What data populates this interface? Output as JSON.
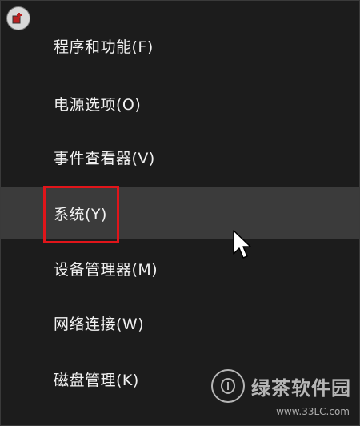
{
  "menu": {
    "items": [
      {
        "label": "程序和功能(F)"
      },
      {
        "label": "电源选项(O)"
      },
      {
        "label": "事件查看器(V)"
      },
      {
        "label": "系统(Y)"
      },
      {
        "label": "设备管理器(M)"
      },
      {
        "label": "网络连接(W)"
      },
      {
        "label": "磁盘管理(K)"
      }
    ],
    "hovered_index": 3
  },
  "start_badge_icon": "start-button-icon",
  "highlight_color": "#e0151a",
  "watermark": {
    "brand": "绿茶软件园",
    "url": "www.33LC.com"
  }
}
